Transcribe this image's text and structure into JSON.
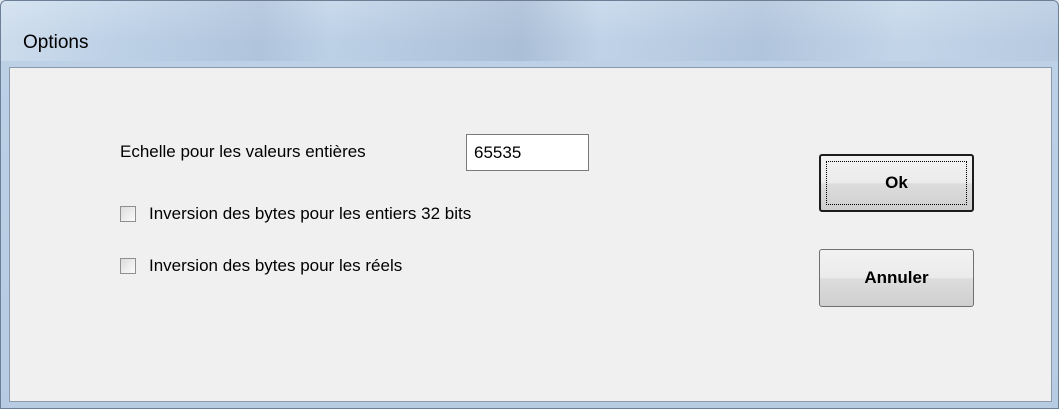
{
  "window": {
    "title": "Options"
  },
  "scale": {
    "label": "Echelle pour les valeurs entières",
    "value": "65535"
  },
  "checkboxes": [
    {
      "label": "Inversion des bytes pour les entiers 32 bits",
      "checked": false
    },
    {
      "label": "Inversion des bytes pour les réels",
      "checked": false
    }
  ],
  "buttons": {
    "ok_label": "Ok",
    "cancel_label": "Annuler"
  }
}
